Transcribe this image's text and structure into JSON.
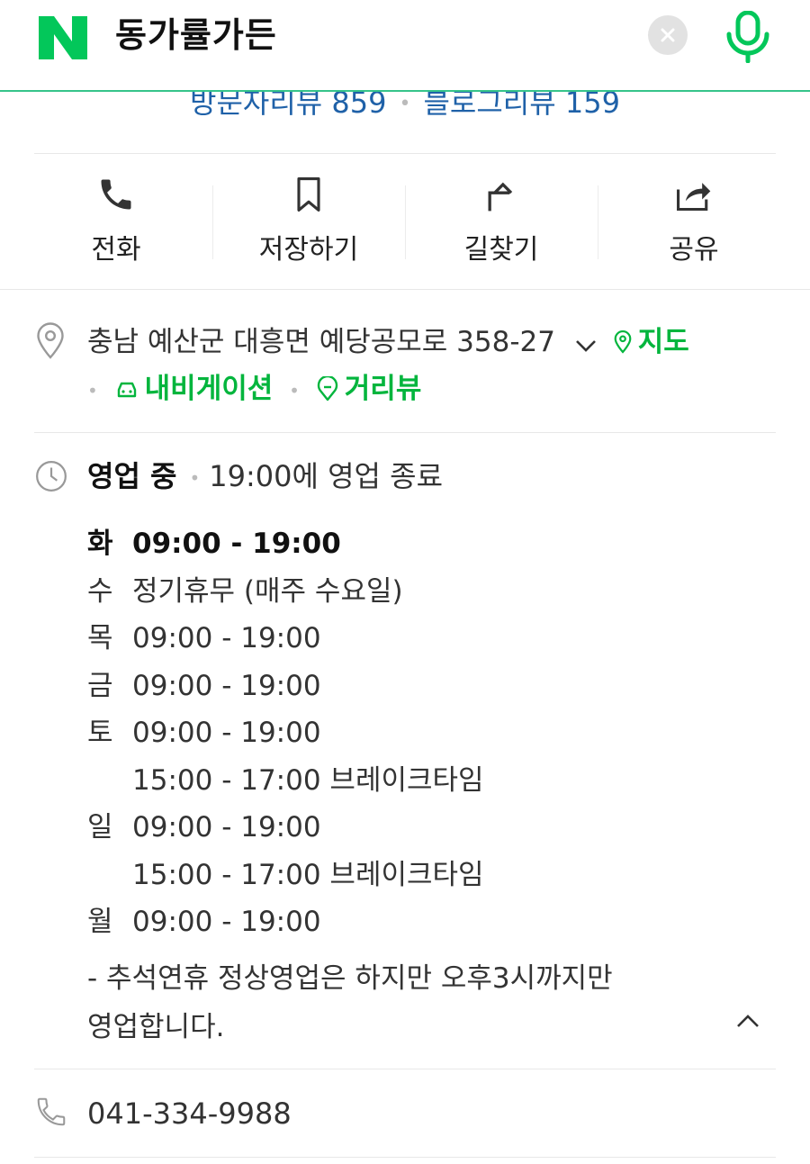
{
  "search": {
    "query": "동가률가든"
  },
  "reviews": {
    "visitor": "방문자리뷰 859",
    "blog": "블로그리뷰 159"
  },
  "actions": [
    {
      "id": "call",
      "label": "전화",
      "icon": "phone-icon"
    },
    {
      "id": "save",
      "label": "저장하기",
      "icon": "bookmark-icon"
    },
    {
      "id": "directions",
      "label": "길찾기",
      "icon": "directions-icon"
    },
    {
      "id": "share",
      "label": "공유",
      "icon": "share-icon"
    }
  ],
  "address": {
    "text": "충남 예산군 대흥면 예당공모로 358-27",
    "map_label": "지도",
    "navigation_label": "내비게이션",
    "streetview_label": "거리뷰"
  },
  "hours": {
    "status": "영업 중",
    "closing": "19:00에 영업 종료",
    "rows": [
      {
        "day": "화",
        "time": "09:00 - 19:00"
      },
      {
        "day": "수",
        "time": "정기휴무 (매주 수요일)"
      },
      {
        "day": "목",
        "time": "09:00 - 19:00"
      },
      {
        "day": "금",
        "time": "09:00 - 19:00"
      },
      {
        "day": "토",
        "time": "09:00 - 19:00"
      },
      {
        "day": "",
        "time": "15:00 - 17:00 브레이크타임"
      },
      {
        "day": "일",
        "time": "09:00 - 19:00"
      },
      {
        "day": "",
        "time": "15:00 - 17:00 브레이크타임"
      },
      {
        "day": "월",
        "time": "09:00 - 19:00"
      }
    ],
    "note_line1": "- 추석연휴 정상영업은 하지만 오후3시까지만",
    "note_line2": "영업합니다."
  },
  "phone": {
    "number": "041-334-9988"
  },
  "colors": {
    "brand_green": "#03c75a",
    "link_green": "#03b53d",
    "review_blue": "#1f61a8"
  }
}
